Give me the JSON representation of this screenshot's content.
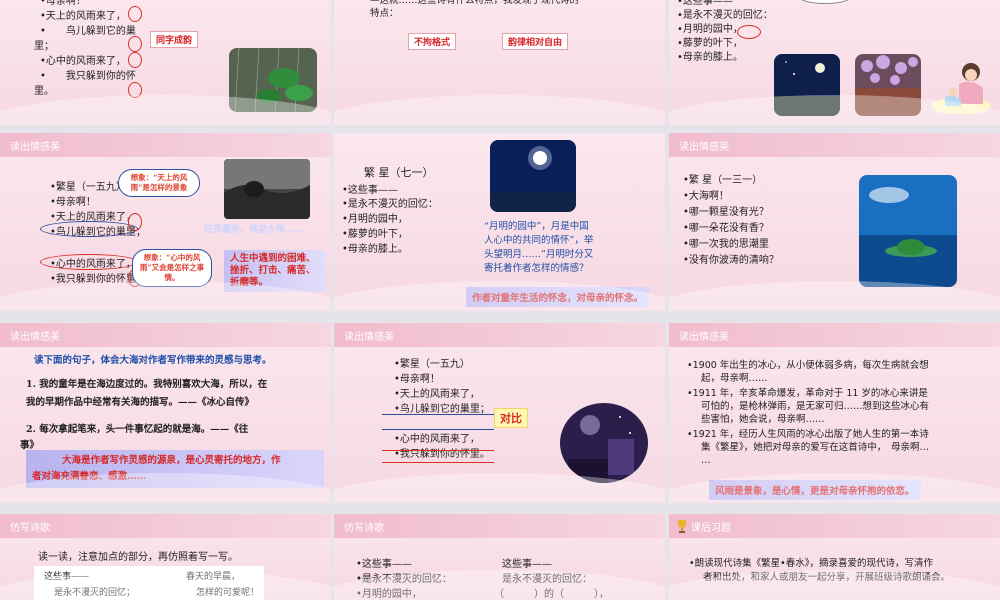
{
  "slide1": {
    "lines": [
      "•母亲啊！",
      "•天上的风雨来了，",
      "•　　鸟儿躲到它的巢",
      "里；",
      "•心中的风雨来了，",
      "•　　我只躲到你的怀",
      "里。"
    ],
    "tag": "同字成韵"
  },
  "slide2": {
    "lines": [
      "—这就……这些诗有什么特点，我发现了现代诗的",
      "特点："
    ],
    "tags": [
      "不拘格式",
      "韵律相对自由"
    ]
  },
  "slide3": {
    "lines": [
      "•这些事——",
      "•是永不漫灭的回忆：",
      "•月明的园中，",
      "•藤萝的叶下，",
      "•母亲的膝上。"
    ]
  },
  "slide4": {
    "header": "读出情感美",
    "lines": [
      "•繁星（一五九）",
      "•母亲啊！",
      "•天上的风雨来了，",
      "•鸟儿躲到它的巢里；",
      "•心中的风雨来了，",
      "•我只躲到你的怀里。"
    ],
    "bubble1": "想象：“天上的风雨”是怎样的景象",
    "bubble2": "想象：“心中的风雨”又会是怎样之事情。",
    "faint": "狂风暴雨、倾盆大雨……",
    "band": "人生中遇到的困难、挫折、打击、痛苦、折磨等。"
  },
  "slide5": {
    "title": "繁 星（七一）",
    "lines": [
      "•这些事——",
      "•是永不漫灭的回忆：",
      "•月明的园中，",
      "•藤萝的叶下，",
      "•母亲的膝上。"
    ],
    "quote": [
      "“月明的园中”，月是中国",
      "人心中的共同的情怀”，举",
      "头望明月……”月明时分又",
      "寄托着作者怎样的情感？"
    ],
    "band": "作者对童年生活的怀念，对母亲的怀念。"
  },
  "slide6": {
    "header": "读出情感美",
    "lines": [
      "•繁 星（一三一）",
      "•大海啊！",
      "•哪一颗星没有光？",
      "•哪一朵花没有香？",
      "•哪一次我的思潮里",
      "•没有你波涛的清响？"
    ]
  },
  "slide7": {
    "header": "读出情感美",
    "prompt": "读下面的句子，体会大海对作者写作带来的灵感与思考。",
    "p1": [
      "1. 我的童年是在海边度过的。我特别喜欢大海，所以，在",
      "我的早期作品中经常有关海的描写。——《冰心自传》"
    ],
    "p2": [
      "2. 每次拿起笔来，头一件事忆起的就是海。——《往",
      "事》"
    ],
    "band": [
      "大海是作者写作灵感的源泉，是心灵寄托的地方，作",
      "者对海充满眷恋、感激……"
    ]
  },
  "slide8": {
    "header": "读出情感美",
    "lines": [
      "•繁星（一五九）",
      "•母亲啊！",
      "•天上的风雨来了，",
      "•鸟儿躲到它的巢里；",
      "•心中的风雨来了，",
      "•我只躲到你的怀里。"
    ],
    "tag": "对比"
  },
  "slide9": {
    "header": "读出情感美",
    "b1": [
      "•1900 年出生的冰心，从小便体弱多病，每次生病就会想",
      "起，母亲啊……"
    ],
    "b2": [
      "•1911 年，辛亥革命爆发，革命对于 11 岁的冰心来讲是",
      "可怕的，是枪林弹雨，是无家可归……想到这些冰心有",
      "些害怕，她会说，母亲啊……"
    ],
    "b3": [
      "•1921 年，经历人生风雨的冰心出版了她人生的第一本诗",
      "集《繁星》，她把对母亲的爱写在这首诗中，　母亲啊…",
      "…"
    ],
    "band": "风雨是景象，是心情，更是对母亲怀抱的依恋。"
  },
  "slide10": {
    "header": "仿写诗歌",
    "lead": "读一读，注意加点的部分，再仿照着写一写。",
    "left": [
      "这些事——",
      "是永不漫灭的回忆；"
    ],
    "right": [
      "春天的早晨，",
      "怎样的可爱呢！"
    ]
  },
  "slide11": {
    "header": "仿写诗歌",
    "left": [
      "•这些事——",
      "•是永不漫灭的回忆：",
      "•月明的园中，"
    ],
    "right": [
      "这些事——",
      "是永不漫灭的回忆：",
      "（　　　）的（　　　），"
    ]
  },
  "slide12": {
    "header": "课后习题",
    "lines": [
      "•朗读现代诗集《繁星•春水》，摘录喜爱的现代诗，写清作",
      "者和出处，和家人或朋友一起分享，开展班级诗歌朗诵会。"
    ]
  }
}
